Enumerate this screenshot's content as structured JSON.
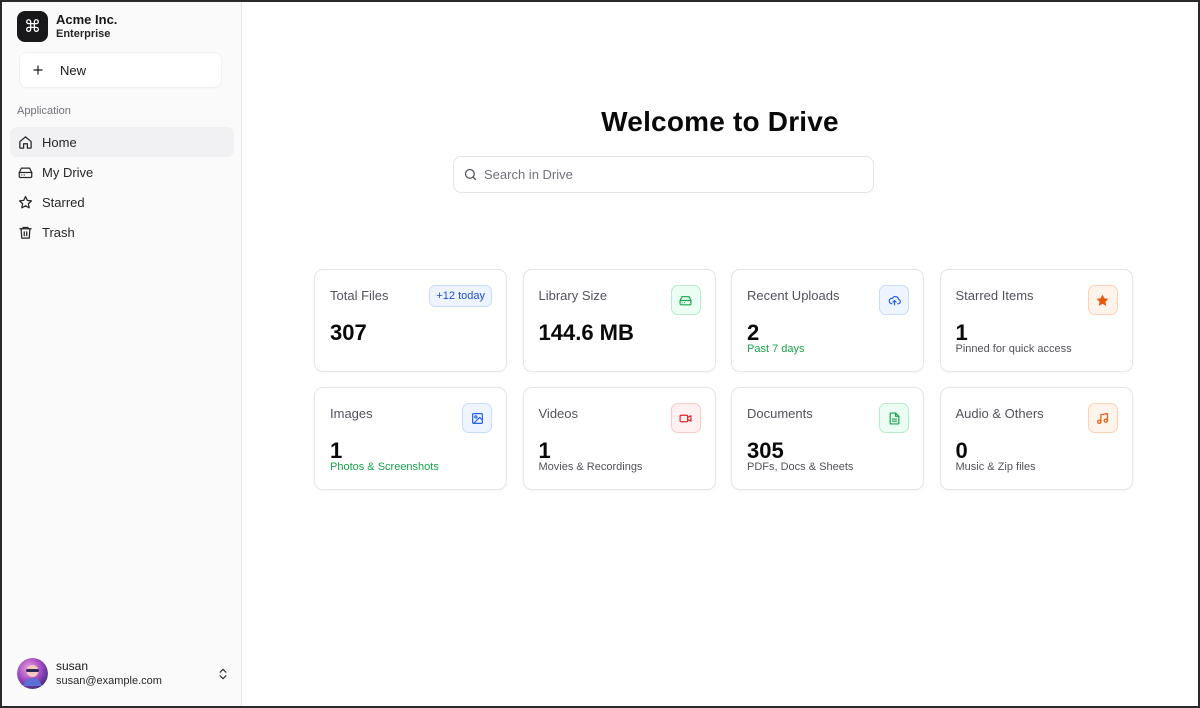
{
  "app": {
    "brand_name": "Acme Inc.",
    "brand_plan": "Enterprise",
    "brand_icon": "command-icon"
  },
  "sidebar": {
    "new_label": "New",
    "group_label": "Application",
    "items": [
      {
        "label": "Home",
        "icon": "home-icon",
        "active": true
      },
      {
        "label": "My Drive",
        "icon": "hard-drive-icon",
        "active": false
      },
      {
        "label": "Starred",
        "icon": "star-icon",
        "active": false
      },
      {
        "label": "Trash",
        "icon": "trash-icon",
        "active": false
      }
    ]
  },
  "user": {
    "name": "susan",
    "email": "susan@example.com"
  },
  "main": {
    "title": "Welcome to Drive",
    "search_placeholder": "Search in Drive",
    "search_value": ""
  },
  "stats": [
    {
      "label": "Total Files",
      "value": "307",
      "sub": "",
      "badge": "+12 today",
      "icon": "",
      "color": "#1d4ed8"
    },
    {
      "label": "Library Size",
      "value": "144.6 MB",
      "sub": "",
      "badge": "",
      "icon": "hard-drive-icon",
      "color": "#16a34a"
    },
    {
      "label": "Recent Uploads",
      "value": "2",
      "sub": "Past 7 days",
      "badge": "",
      "icon": "cloud-upload-icon",
      "color": "#2563eb"
    },
    {
      "label": "Starred Items",
      "value": "1",
      "sub": "Pinned for quick access",
      "badge": "",
      "icon": "star-icon",
      "color": "#ea580c"
    },
    {
      "label": "Images",
      "value": "1",
      "sub": "Photos & Screenshots",
      "badge": "",
      "icon": "image-icon",
      "color": "#2563eb"
    },
    {
      "label": "Videos",
      "value": "1",
      "sub": "Movies & Recordings",
      "badge": "",
      "icon": "video-icon",
      "color": "#dc2626"
    },
    {
      "label": "Documents",
      "value": "305",
      "sub": "PDFs, Docs & Sheets",
      "badge": "",
      "icon": "file-text-icon",
      "color": "#16a34a"
    },
    {
      "label": "Audio & Others",
      "value": "0",
      "sub": "Music & Zip files",
      "badge": "",
      "icon": "music-icon",
      "color": "#ea580c"
    }
  ]
}
